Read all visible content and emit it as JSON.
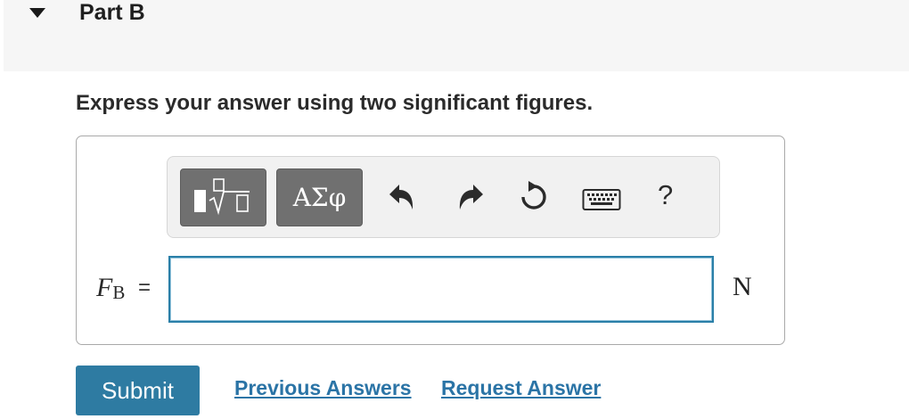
{
  "part": {
    "title": "Part B"
  },
  "instructions": "Express your answer using two significant figures.",
  "toolbar": {
    "greek_label": "ΑΣφ",
    "help_label": "?",
    "buttons": [
      "templates-icon",
      "greek-letters",
      "undo-icon",
      "redo-icon",
      "reset-icon",
      "keyboard-icon",
      "help-icon"
    ]
  },
  "answer": {
    "variable_symbol": "F",
    "variable_subscript": "B",
    "equals": "=",
    "value": "",
    "unit": "N"
  },
  "actions": {
    "submit_label": "Submit",
    "previous_answers_label": "Previous Answers",
    "request_answer_label": "Request Answer"
  },
  "colors": {
    "header_bg": "#f6f6f6",
    "accent": "#2e7ba2",
    "link": "#2b74a6",
    "toolbar_button": "#707070",
    "input_border": "#2a7fa8"
  }
}
